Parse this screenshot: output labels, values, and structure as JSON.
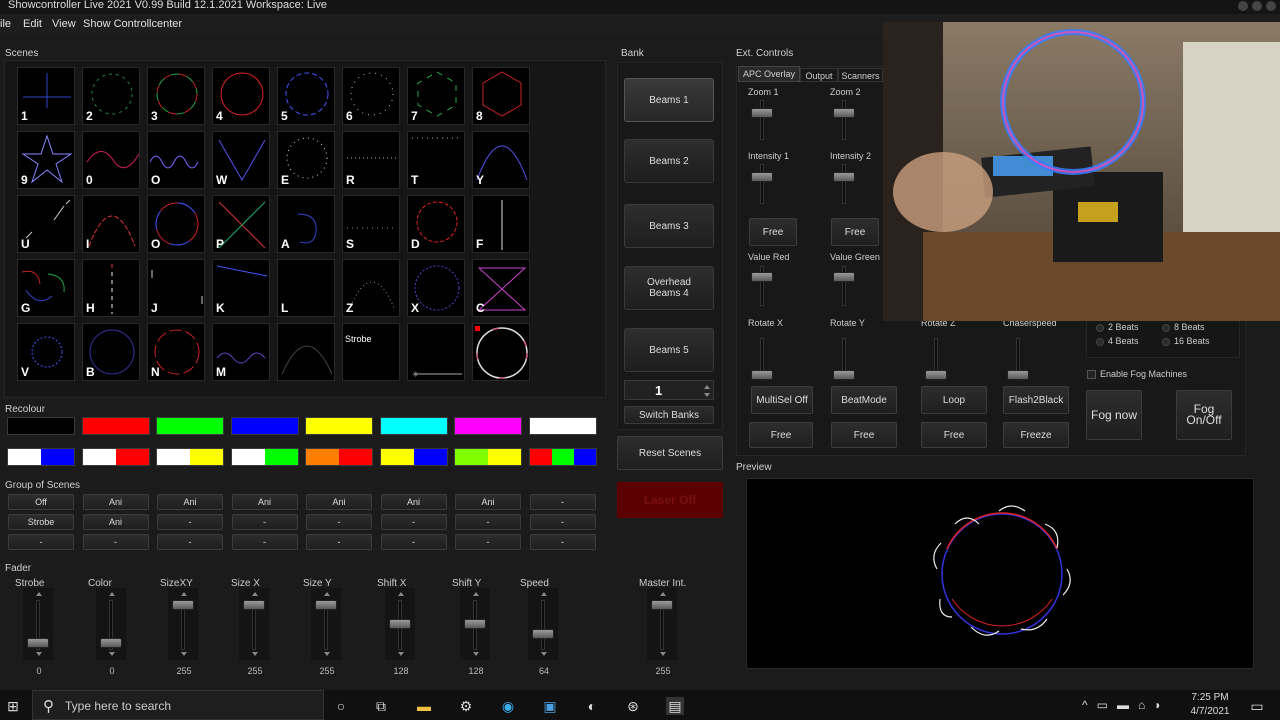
{
  "window": {
    "title": "Showcontroller Live 2021 V0.99 Build 12.1.2021  Workspace: Live"
  },
  "menu": [
    "ile",
    "Edit",
    "View",
    "Show Controllcenter"
  ],
  "scenes": {
    "label": "Scenes",
    "items": [
      {
        "label": "1",
        "art": "cross"
      },
      {
        "label": "2",
        "art": "circle-green"
      },
      {
        "label": "3",
        "art": "circle-rgb"
      },
      {
        "label": "4",
        "art": "circle-red"
      },
      {
        "label": "5",
        "art": "circle-dashed-blue"
      },
      {
        "label": "6",
        "art": "circle-dotted-white"
      },
      {
        "label": "7",
        "art": "hexagon"
      },
      {
        "label": "8",
        "art": "hexagon-red"
      },
      {
        "label": "9",
        "art": "star"
      },
      {
        "label": "0",
        "art": "sine"
      },
      {
        "label": "O",
        "art": "wave"
      },
      {
        "label": "W",
        "art": "vee"
      },
      {
        "label": "E",
        "art": "circle-dots"
      },
      {
        "label": "R",
        "art": "dots-line"
      },
      {
        "label": "T",
        "art": "dots-line2"
      },
      {
        "label": "Y",
        "art": "peak"
      },
      {
        "label": "U",
        "art": "dashes"
      },
      {
        "label": "I",
        "art": "peak-red"
      },
      {
        "label": "O",
        "art": "circle-rgb2"
      },
      {
        "label": "P",
        "art": "x-cross"
      },
      {
        "label": "A",
        "art": "swirl"
      },
      {
        "label": "S",
        "art": "dots-line3"
      },
      {
        "label": "D",
        "art": "flower"
      },
      {
        "label": "F",
        "art": "vline"
      },
      {
        "label": "G",
        "art": "swirls"
      },
      {
        "label": "H",
        "art": "vdash"
      },
      {
        "label": "J",
        "art": "dashes2"
      },
      {
        "label": "K",
        "art": "diag"
      },
      {
        "label": "L",
        "art": "empty"
      },
      {
        "label": "Z",
        "art": "arc-dots"
      },
      {
        "label": "X",
        "art": "circle-purple"
      },
      {
        "label": "C",
        "art": "hourglass"
      },
      {
        "label": "V",
        "art": "circle-blue-small"
      },
      {
        "label": "B",
        "art": "circle-dark"
      },
      {
        "label": "N",
        "art": "circle-red2"
      },
      {
        "label": "M",
        "art": "wave2"
      },
      {
        "label": "",
        "art": "arc"
      },
      {
        "label": "",
        "art": "empty",
        "top_label": "Strobe"
      },
      {
        "label": "",
        "art": "hline-dots"
      },
      {
        "label": "",
        "art": "circle-white-red"
      }
    ]
  },
  "bank": {
    "label": "Bank",
    "items": [
      "Beams 1",
      "Beams 2",
      "Beams 3",
      "Overhead Beams 4",
      "Beams 5"
    ],
    "active": 0,
    "spinner_value": "1",
    "switch_banks": "Switch Banks",
    "reset_scenes": "Reset Scenes",
    "laser_off": "Laser Off"
  },
  "ext": {
    "label": "Ext. Controls",
    "tabs": [
      "APC Overlay",
      "Output",
      "Scanners"
    ],
    "active_tab": 0,
    "zoom1": "Zoom 1",
    "zoom2": "Zoom 2",
    "intensity1": "Intensity 1",
    "intensity2": "Intensity 2",
    "free": "Free",
    "value_red": "Value Red",
    "value_green": "Value Green",
    "rotate_x": "Rotate X",
    "rotate_y": "Rotate Y",
    "rotate_z": "Rotate Z",
    "chaserspeed": "Chaserspeed",
    "multisel": "MultiSel Off",
    "beatmode": "BeatMode",
    "loop": "Loop",
    "flash2black": "Flash2Black",
    "freeze": "Freeze",
    "beats": [
      "2 Beats",
      "8 Beats",
      "4 Beats",
      "16 Beats"
    ],
    "enable_fog": "Enable Fog Machines",
    "fog_now": "Fog now",
    "fog_onoff": "Fog On/Off"
  },
  "recolour": {
    "label": "Recolour",
    "row1": [
      "#000000",
      "#ff0000",
      "#00ff00",
      "#0000ff",
      "#ffff00",
      "#00ffff",
      "#ff00ff",
      "#ffffff"
    ],
    "row2": [
      [
        "#ffffff",
        "#0000ff"
      ],
      [
        "#ffffff",
        "#ff0000"
      ],
      [
        "#ffffff",
        "#ffff00"
      ],
      [
        "#ffffff",
        "#00ff00"
      ],
      [
        "#ff8000",
        "#ff0000"
      ],
      [
        "#ffff00",
        "#0000ff"
      ],
      [
        "#80ff00",
        "#ffff00"
      ],
      [
        "#ff0000",
        "#00ff00",
        "#0000ff"
      ]
    ]
  },
  "group_of_scenes": {
    "label": "Group of Scenes",
    "rows": [
      [
        "Off",
        "Ani",
        "Ani",
        "Ani",
        "Ani",
        "Ani",
        "Ani",
        "-"
      ],
      [
        "Strobe",
        "Ani",
        "-",
        "-",
        "-",
        "-",
        "-",
        "-"
      ],
      [
        "-",
        "-",
        "-",
        "-",
        "-",
        "-",
        "-",
        "-"
      ]
    ]
  },
  "fader": {
    "label": "Fader",
    "items": [
      {
        "name": "Strobe",
        "value": "0",
        "level": 0
      },
      {
        "name": "Color",
        "value": "0",
        "level": 0
      },
      {
        "name": "SizeXY",
        "value": "255",
        "level": 1
      },
      {
        "name": "Size X",
        "value": "255",
        "level": 1
      },
      {
        "name": "Size Y",
        "value": "255",
        "level": 1
      },
      {
        "name": "Shift X",
        "value": "128",
        "level": 0.5
      },
      {
        "name": "Shift Y",
        "value": "128",
        "level": 0.5
      },
      {
        "name": "Speed",
        "value": "64",
        "level": 0.25
      }
    ],
    "master": {
      "name": "Master Int.",
      "value": "255",
      "level": 1
    }
  },
  "preview": {
    "label": "Preview"
  },
  "taskbar": {
    "search_placeholder": "Type here to search",
    "time": "7:25 PM",
    "date": "4/7/2021"
  }
}
